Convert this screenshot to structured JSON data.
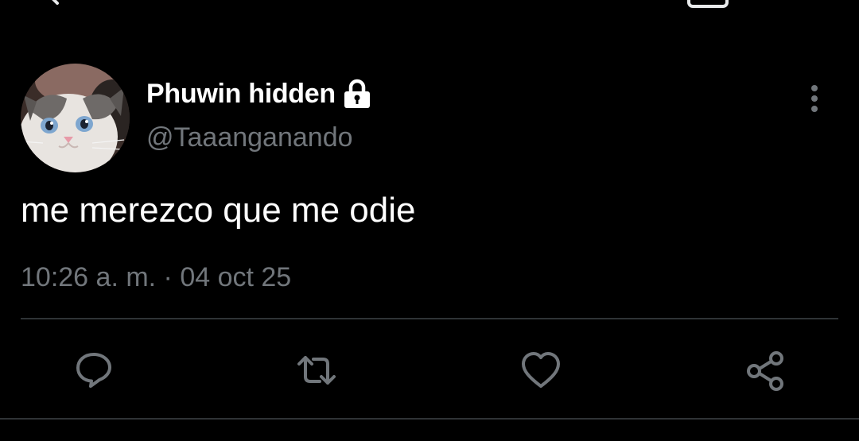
{
  "tweet": {
    "author": {
      "display_name": "Phuwin hidden",
      "handle": "@Taaanganando",
      "protected": true
    },
    "text": "me merezco que me odie",
    "timestamp": "10:26 a. m. · 04 oct 25"
  },
  "actions": {
    "reply": "reply-icon",
    "retweet": "retweet-icon",
    "like": "heart-icon",
    "share": "share-icon"
  },
  "colors": {
    "background": "#000000",
    "primary_text": "#ffffff",
    "secondary_text": "#71767b",
    "icon": "#71767b",
    "divider": "#2f3336"
  }
}
